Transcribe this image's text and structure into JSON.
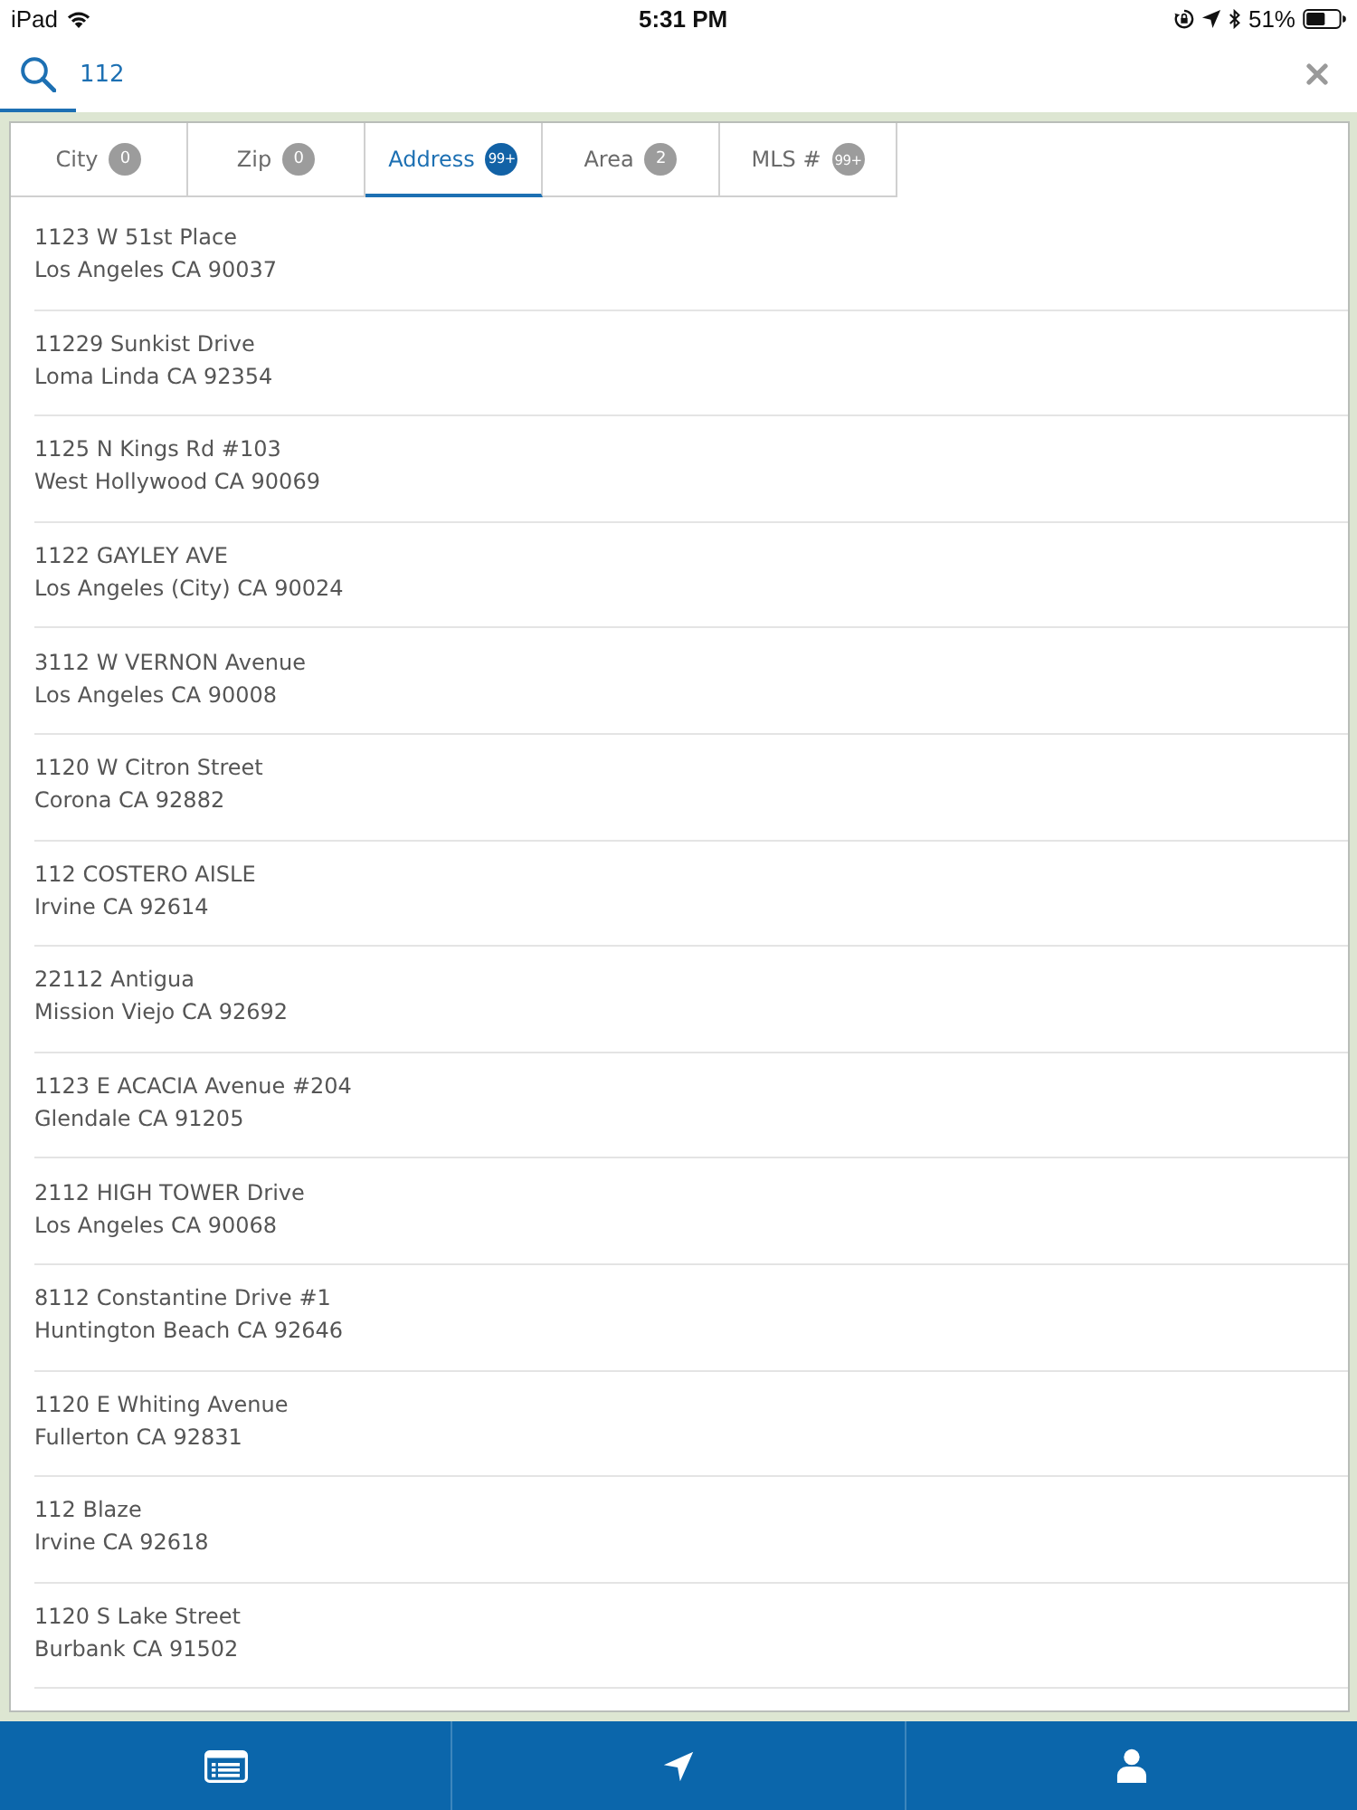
{
  "status_bar": {
    "device": "iPad",
    "time": "5:31 PM",
    "battery": "51%"
  },
  "search": {
    "value": "112"
  },
  "tabs": [
    {
      "label": "City",
      "count": "0",
      "selected": false
    },
    {
      "label": "Zip",
      "count": "0",
      "selected": false
    },
    {
      "label": "Address",
      "count": "99+",
      "selected": true
    },
    {
      "label": "Area",
      "count": "2",
      "selected": false
    },
    {
      "label": "MLS #",
      "count": "99+",
      "selected": false
    }
  ],
  "results": [
    {
      "street": "1123 W 51st Place",
      "city": "Los Angeles CA 90037"
    },
    {
      "street": "11229 Sunkist Drive",
      "city": "Loma Linda CA 92354"
    },
    {
      "street": "1125 N Kings Rd #103",
      "city": "West Hollywood CA 90069"
    },
    {
      "street": "1122 GAYLEY AVE",
      "city": "Los Angeles (City) CA 90024"
    },
    {
      "street": "3112 W VERNON Avenue",
      "city": "Los Angeles CA 90008"
    },
    {
      "street": "1120 W Citron Street",
      "city": "Corona CA 92882"
    },
    {
      "street": "112 COSTERO AISLE",
      "city": "Irvine CA 92614"
    },
    {
      "street": "22112 Antigua",
      "city": "Mission Viejo CA 92692"
    },
    {
      "street": "1123 E ACACIA Avenue #204",
      "city": "Glendale CA 91205"
    },
    {
      "street": "2112 HIGH TOWER Drive",
      "city": "Los Angeles CA 90068"
    },
    {
      "street": "8112 Constantine Drive #1",
      "city": "Huntington Beach CA 92646"
    },
    {
      "street": "1120 E Whiting Avenue",
      "city": "Fullerton CA 92831"
    },
    {
      "street": "112 Blaze",
      "city": "Irvine CA 92618"
    },
    {
      "street": "1120 S Lake Street",
      "city": "Burbank CA 91502"
    }
  ]
}
